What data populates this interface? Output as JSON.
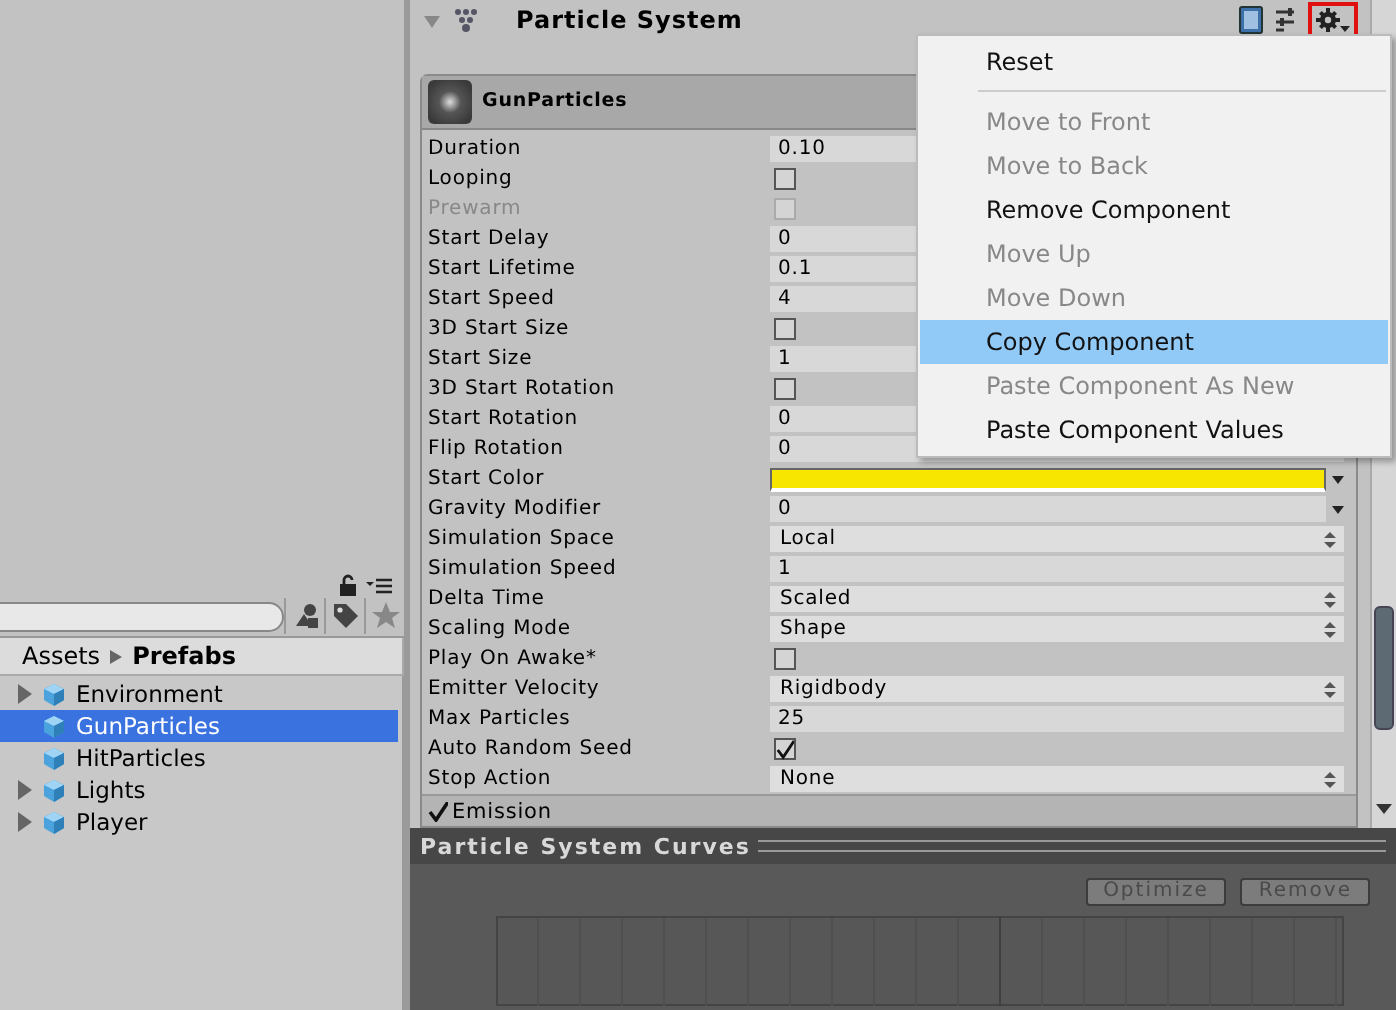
{
  "project": {
    "breadcrumb": [
      "Assets",
      "Prefabs"
    ],
    "items": [
      {
        "label": "Environment",
        "expandable": true,
        "selected": false
      },
      {
        "label": "GunParticles",
        "expandable": false,
        "selected": true
      },
      {
        "label": "HitParticles",
        "expandable": false,
        "selected": false
      },
      {
        "label": "Lights",
        "expandable": true,
        "selected": false
      },
      {
        "label": "Player",
        "expandable": true,
        "selected": false
      }
    ]
  },
  "inspector": {
    "title": "Particle System",
    "module": "GunParticles",
    "rows": [
      {
        "label": "Duration",
        "kind": "number",
        "value": "0.10"
      },
      {
        "label": "Looping",
        "kind": "checkbox",
        "checked": false,
        "disabled": false
      },
      {
        "label": "Prewarm",
        "kind": "checkbox",
        "checked": false,
        "disabled": true
      },
      {
        "label": "Start Delay",
        "kind": "number",
        "value": "0"
      },
      {
        "label": "Start Lifetime",
        "kind": "number",
        "value": "0.1"
      },
      {
        "label": "Start Speed",
        "kind": "number",
        "value": "4"
      },
      {
        "label": "3D Start Size",
        "kind": "checkbox",
        "checked": false,
        "disabled": false
      },
      {
        "label": "Start Size",
        "kind": "number",
        "value": "1"
      },
      {
        "label": "3D Start Rotation",
        "kind": "checkbox",
        "checked": false,
        "disabled": false
      },
      {
        "label": "Start Rotation",
        "kind": "number",
        "value": "0"
      },
      {
        "label": "Flip Rotation",
        "kind": "number",
        "value": "0"
      },
      {
        "label": "Start Color",
        "kind": "color",
        "color": "#f6e600"
      },
      {
        "label": "Gravity Modifier",
        "kind": "curve",
        "value": "0"
      },
      {
        "label": "Simulation Space",
        "kind": "dropdown",
        "value": "Local"
      },
      {
        "label": "Simulation Speed",
        "kind": "number",
        "value": "1"
      },
      {
        "label": "Delta Time",
        "kind": "dropdown",
        "value": "Scaled"
      },
      {
        "label": "Scaling Mode",
        "kind": "dropdown",
        "value": "Shape"
      },
      {
        "label": "Play On Awake*",
        "kind": "checkbox",
        "checked": false,
        "disabled": false
      },
      {
        "label": "Emitter Velocity",
        "kind": "dropdown",
        "value": "Rigidbody"
      },
      {
        "label": "Max Particles",
        "kind": "number",
        "value": "25"
      },
      {
        "label": "Auto Random Seed",
        "kind": "checkbox",
        "checked": true,
        "disabled": false
      },
      {
        "label": "Stop Action",
        "kind": "dropdown",
        "value": "None"
      }
    ],
    "emission": {
      "label": "Emission",
      "checked": true
    }
  },
  "curves": {
    "title": "Particle System Curves",
    "buttons": [
      "Optimize",
      "Remove"
    ]
  },
  "menu": {
    "items": [
      {
        "kind": "item",
        "label": "Reset",
        "disabled": false,
        "selected": false
      },
      {
        "kind": "separator"
      },
      {
        "kind": "item",
        "label": "Move to Front",
        "disabled": true,
        "selected": false
      },
      {
        "kind": "item",
        "label": "Move to Back",
        "disabled": true,
        "selected": false
      },
      {
        "kind": "item",
        "label": "Remove Component",
        "disabled": false,
        "selected": false
      },
      {
        "kind": "item",
        "label": "Move Up",
        "disabled": true,
        "selected": false
      },
      {
        "kind": "item",
        "label": "Move Down",
        "disabled": true,
        "selected": false
      },
      {
        "kind": "item",
        "label": "Copy Component",
        "disabled": false,
        "selected": true
      },
      {
        "kind": "item",
        "label": "Paste Component As New",
        "disabled": true,
        "selected": false
      },
      {
        "kind": "item",
        "label": "Paste Component Values",
        "disabled": false,
        "selected": false
      }
    ]
  }
}
